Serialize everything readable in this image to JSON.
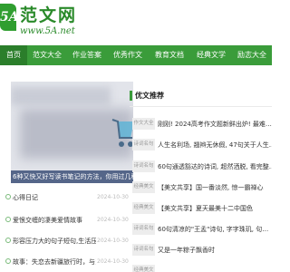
{
  "header": {
    "logo_badge": "5A",
    "site_name": "范文网",
    "site_url": "www.5A.net"
  },
  "nav": {
    "items": [
      {
        "label": "首页",
        "active": true
      },
      {
        "label": "范文大全",
        "active": false
      },
      {
        "label": "作业答案",
        "active": false
      },
      {
        "label": "优秀作文",
        "active": false
      },
      {
        "label": "教育文档",
        "active": false
      },
      {
        "label": "经典文学",
        "active": false
      },
      {
        "label": "励志大全",
        "active": false
      }
    ]
  },
  "banner": {
    "caption": "6种又快又好写读书笔记的方法，你用过几种"
  },
  "left_list": [
    {
      "title": "心得日记",
      "date": "2024-10-30"
    },
    {
      "title": "爱恨交缠的凄美爱情故事",
      "date": "2024-10-30"
    },
    {
      "title": "形容压力大的句子短句,生活压力经典句",
      "date": "2024-10-30"
    },
    {
      "title": "故事：失恋去新疆旅行时，与当地漂亮",
      "date": "2024-10-30"
    }
  ],
  "recommend": {
    "title": "优文推荐",
    "items": [
      {
        "tag": "作文大全",
        "text": "刚刚! 2024高考作文题新鲜出炉! 最难…"
      },
      {
        "tag": "诗词名句",
        "text": "人生名利场, 翘辫无休假, 47句关于人生…"
      },
      {
        "tag": "诗词名句",
        "text": "60句通透豁达的诗词, 超然洒脱, 看完整…"
      },
      {
        "tag": "经典美文",
        "text": "【美文共享】国一番淡然, 惊一霸禅心"
      },
      {
        "tag": "经典美文",
        "text": "【美文共享】夏天最美十二中国色"
      },
      {
        "tag": "诗词名句",
        "text": "60句清凉的\"王孟\"诗句, 字字珠玑, 句…"
      },
      {
        "tag": "诗词名句",
        "text": "又是一年粽子飘香时"
      },
      {
        "tag": "经典美文",
        "text": ""
      }
    ]
  }
}
